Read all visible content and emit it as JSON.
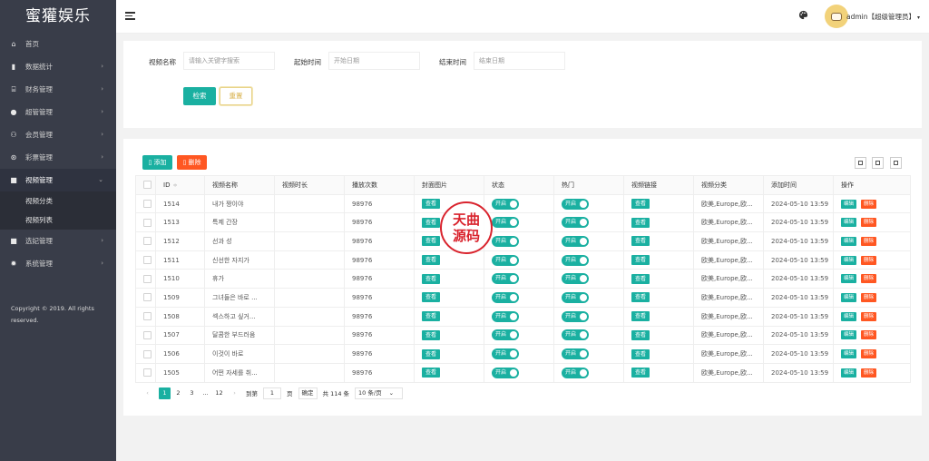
{
  "app": {
    "title": "蜜獾娱乐"
  },
  "sidebar": {
    "items": [
      {
        "label": "首页",
        "icon": "home-icon"
      },
      {
        "label": "数据统计",
        "icon": "bar-chart-icon"
      },
      {
        "label": "财务管理",
        "icon": "bank-icon"
      },
      {
        "label": "超管管理",
        "icon": "user-icon"
      },
      {
        "label": "会员管理",
        "icon": "users-icon"
      },
      {
        "label": "彩票管理",
        "icon": "gamepad-icon"
      },
      {
        "label": "视频管理",
        "icon": "video-icon"
      },
      {
        "label": "选妃管理",
        "icon": "video-icon"
      },
      {
        "label": "系统管理",
        "icon": "gear-icon"
      }
    ],
    "sub_items": [
      "视频分类",
      "视频列表"
    ],
    "copyright": "Copyright © 2019. All rights reserved."
  },
  "header": {
    "user": "admin【超级管理员】"
  },
  "filters": {
    "name_label": "视频名称",
    "name_placeholder": "请输入关键字搜索",
    "start_label": "起始时间",
    "start_placeholder": "开始日期",
    "end_label": "结束时间",
    "end_placeholder": "结束日期",
    "search_label": "检索",
    "reset_label": "重置"
  },
  "toolbar": {
    "add_label": "添加",
    "delete_label": "删除"
  },
  "table": {
    "headers": [
      "ID",
      "视频名称",
      "视频时长",
      "播放次数",
      "封面图片",
      "状态",
      "热门",
      "视频链接",
      "视频分类",
      "添加时间",
      "操作"
    ],
    "view_label": "查看",
    "on_label": "开启",
    "edit_label": "编辑",
    "remove_label": "删除",
    "rows": [
      {
        "id": "1514",
        "name": "내가 짱이야",
        "plays": "98976",
        "category": "欧美,Europe,欧...",
        "time": "2024-05-10 13:59"
      },
      {
        "id": "1513",
        "name": "특제 간장",
        "plays": "98976",
        "category": "欧美,Europe,欧...",
        "time": "2024-05-10 13:59"
      },
      {
        "id": "1512",
        "name": "선과 성",
        "plays": "98976",
        "category": "欧美,Europe,欧...",
        "time": "2024-05-10 13:59"
      },
      {
        "id": "1511",
        "name": "신선한 자지가",
        "plays": "98976",
        "category": "欧美,Europe,欧...",
        "time": "2024-05-10 13:59"
      },
      {
        "id": "1510",
        "name": "휴가",
        "plays": "98976",
        "category": "欧美,Europe,欧...",
        "time": "2024-05-10 13:59"
      },
      {
        "id": "1509",
        "name": "그녀들은 바로 ...",
        "plays": "98976",
        "category": "欧美,Europe,欧...",
        "time": "2024-05-10 13:59"
      },
      {
        "id": "1508",
        "name": "섹스하고 싶거...",
        "plays": "98976",
        "category": "欧美,Europe,欧...",
        "time": "2024-05-10 13:59"
      },
      {
        "id": "1507",
        "name": "달콤한 부드러움",
        "plays": "98976",
        "category": "欧美,Europe,欧...",
        "time": "2024-05-10 13:59"
      },
      {
        "id": "1506",
        "name": "이것이 바로",
        "plays": "98976",
        "category": "欧美,Europe,欧...",
        "time": "2024-05-10 13:59"
      },
      {
        "id": "1505",
        "name": "어떤 자세를 취...",
        "plays": "98976",
        "category": "欧美,Europe,欧...",
        "time": "2024-05-10 13:59"
      }
    ]
  },
  "pagination": {
    "pages": [
      "1",
      "2",
      "3",
      "...",
      "12"
    ],
    "goto_label": "到第",
    "goto_value": "1",
    "page_unit": "页",
    "confirm_label": "确定",
    "total": "共 114 条",
    "page_size": "10 条/页"
  },
  "watermark": {
    "line1": "天曲",
    "line2": "源码"
  }
}
